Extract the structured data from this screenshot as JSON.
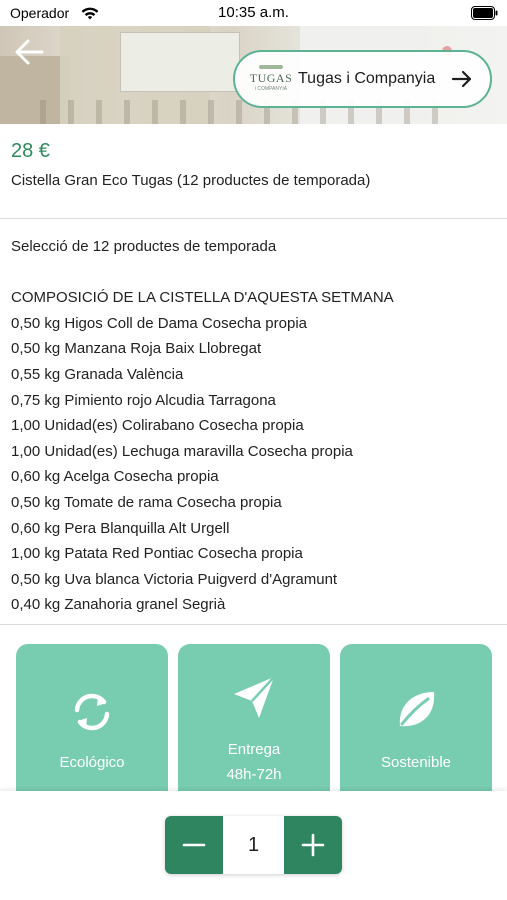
{
  "status_bar": {
    "carrier": "Operador",
    "time": "10:35 a.m."
  },
  "hero": {
    "vendor_logo_text": "TUGAS",
    "vendor_logo_subtext": "i COMPANYIA",
    "vendor_name": "Tugas i Companyia"
  },
  "product": {
    "price": "28 €",
    "title": "Cistella Gran Eco Tugas (12 productes de temporada)",
    "intro": "Selecció de 12 productes de temporada",
    "composition_heading": "COMPOSICIÓ DE LA CISTELLA D'AQUESTA SETMANA",
    "items": [
      "0,50 kg Higos Coll de Dama Cosecha propia",
      "0,50 kg Manzana Roja Baix Llobregat",
      "0,55 kg Granada València",
      "0,75 kg Pimiento rojo Alcudia Tarragona",
      "1,00 Unidad(es) Colirabano Cosecha propia",
      "1,00 Unidad(es) Lechuga maravilla Cosecha propia",
      "0,60 kg Acelga Cosecha propia",
      "0,50 kg Tomate de rama Cosecha propia",
      "0,60 kg Pera Blanquilla Alt Urgell",
      "1,00 kg Patata Red Pontiac Cosecha propia",
      "0,50 kg Uva blanca Victoria Puigverd d'Agramunt",
      "0,40 kg Zanahoria granel Segrià"
    ]
  },
  "features": [
    {
      "icon": "recycle-icon",
      "label": "Ecológico"
    },
    {
      "icon": "send-icon",
      "label_line1": "Entrega",
      "label_line2": "48h-72h"
    },
    {
      "icon": "leaf-icon",
      "label": "Sostenible"
    }
  ],
  "stepper": {
    "quantity": "1"
  },
  "colors": {
    "price_green": "#2f8a5e",
    "card_green": "#78ccb0",
    "button_green": "#2e8560"
  }
}
